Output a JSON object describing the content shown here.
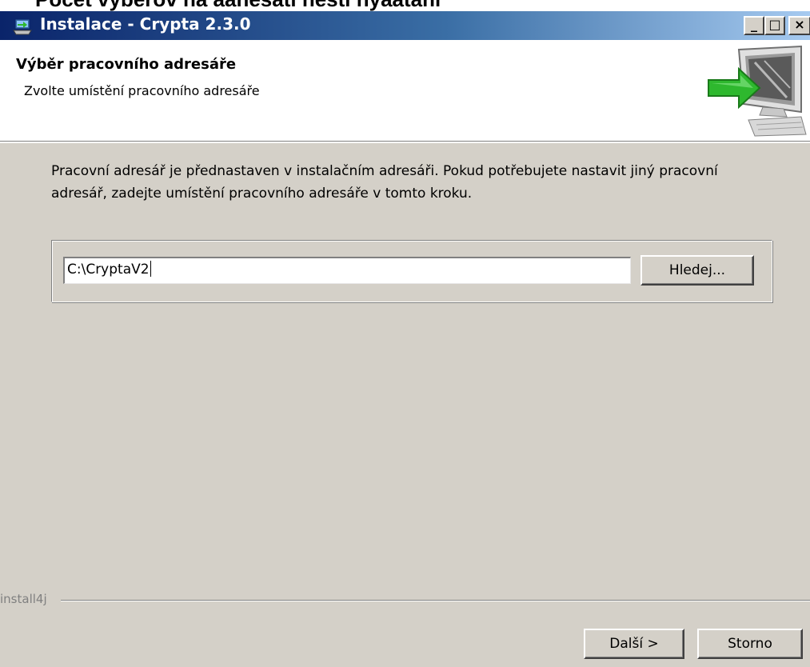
{
  "window": {
    "title": "Instalace - Crypta 2.3.0",
    "controls": {
      "minimize": "_",
      "maximize": "□",
      "close": "×"
    }
  },
  "header": {
    "title": "Výběr pracovního adresáře",
    "subtitle": "Zvolte umístění pracovního adresáře",
    "graphic_icon": "monitor-with-green-arrow-icon"
  },
  "main": {
    "description": "Pracovní adresář je přednastaven v instalačním adresáři. Pokud potřebujete nastavit jiný pracovní adresář, zadejte umístění pracovního adresáře v tomto kroku.",
    "directory_value": "C:\\CryptaV2",
    "browse_label": "Hledej..."
  },
  "footer": {
    "brand": "install4j",
    "next_label": "Další >",
    "cancel_label": "Storno"
  },
  "colors": {
    "dialog_bg": "#d4d0c8",
    "titlebar_start": "#0a246a",
    "titlebar_end": "#a6caf0",
    "accent_arrow": "#2eb82e"
  }
}
